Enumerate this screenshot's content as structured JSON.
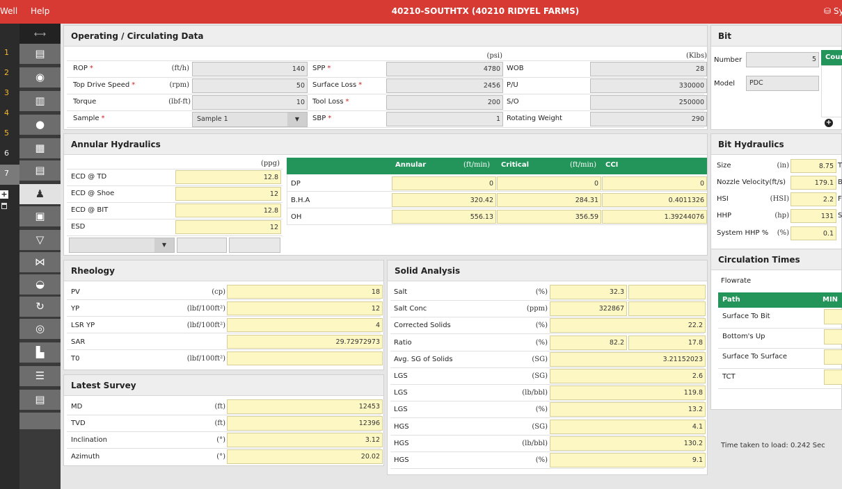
{
  "menu": {
    "well": "Well",
    "help": "Help",
    "title": "40210-SOUTHTX (40210 RIDYEL FARMS)",
    "sys": "Sy"
  },
  "nav": {
    "numbers": [
      "1",
      "2",
      "3",
      "4",
      "5",
      "6",
      "7"
    ],
    "resize_glyph": "⟷"
  },
  "op": {
    "title": "Operating / Circulating Data",
    "u_psi": "(psi)",
    "u_klbs": "(Klbs)",
    "rop": {
      "label": "ROP",
      "unit": "(ft/h)",
      "value": "140"
    },
    "tds": {
      "label": "Top Drive Speed",
      "unit": "(rpm)",
      "value": "50"
    },
    "torque": {
      "label": "Torque",
      "unit": "(lbf-ft)",
      "value": "10"
    },
    "sample": {
      "label": "Sample",
      "value": "Sample 1"
    },
    "spp": {
      "label": "SPP",
      "value": "4780"
    },
    "surface_loss": {
      "label": "Surface Loss",
      "value": "2456"
    },
    "tool_loss": {
      "label": "Tool Loss",
      "value": "200"
    },
    "sbp": {
      "label": "SBP",
      "value": "1"
    },
    "wob": {
      "label": "WOB",
      "value": "28"
    },
    "pu": {
      "label": "P/U",
      "value": "330000"
    },
    "so": {
      "label": "S/O",
      "value": "250000"
    },
    "rw": {
      "label": "Rotating Weight",
      "value": "290"
    }
  },
  "bit": {
    "title": "Bit",
    "number_label": "Number",
    "number_value": "5",
    "model_label": "Model",
    "model_value": "PDC",
    "green_tab": "Coun"
  },
  "ah": {
    "title": "Annular Hydraulics",
    "unit": "(ppg)",
    "rows": [
      {
        "label": "ECD @ TD",
        "value": "12.8"
      },
      {
        "label": "ECD @ Shoe",
        "value": "12"
      },
      {
        "label": "ECD @ BIT",
        "value": "12.8"
      },
      {
        "label": "ESD",
        "value": "12"
      }
    ],
    "grid_headers": {
      "annular": "Annular",
      "annular_unit": "(ft/min)",
      "critical": "Critical",
      "critical_unit": "(ft/min)",
      "cci": "CCI"
    },
    "grid_rows": [
      {
        "label": "DP",
        "annular": "0",
        "critical": "0",
        "cci": "0"
      },
      {
        "label": "B.H.A",
        "annular": "320.42",
        "critical": "284.31",
        "cci": "0.4011326"
      },
      {
        "label": "OH",
        "annular": "556.13",
        "critical": "356.59",
        "cci": "1.39244076"
      }
    ]
  },
  "bh": {
    "title": "Bit Hydraulics",
    "rows": [
      {
        "label": "Size",
        "unit": "(in)",
        "value": "8.75",
        "extra": "T"
      },
      {
        "label": "Nozzle Velocity(ft/s)",
        "unit": "",
        "value": "179.1",
        "extra": "B"
      },
      {
        "label": "HSI",
        "unit": "(HSI)",
        "value": "2.2",
        "extra": "F"
      },
      {
        "label": "HHP",
        "unit": "(hp)",
        "value": "131",
        "extra": "S"
      },
      {
        "label": "System HHP %",
        "unit": "(%)",
        "value": "0.1",
        "extra": ""
      }
    ]
  },
  "rh": {
    "title": "Rheology",
    "rows": [
      {
        "label": "PV",
        "unit": "(cp)",
        "value": "18"
      },
      {
        "label": "YP",
        "unit": "(lbf/100ft²)",
        "value": "12"
      },
      {
        "label": "LSR YP",
        "unit": "(lbf/100ft²)",
        "value": "4"
      },
      {
        "label": "SAR",
        "unit": "",
        "value": "29.72972973"
      },
      {
        "label": "T0",
        "unit": "(lbf/100ft²)",
        "value": ""
      }
    ]
  },
  "sa": {
    "title": "Solid Analysis",
    "rows": [
      {
        "label": "Salt",
        "unit": "(%)",
        "v1": "32.3",
        "v2": ""
      },
      {
        "label": "Salt Conc",
        "unit": "(ppm)",
        "v1": "322867",
        "v2": ""
      },
      {
        "label": "Corrected Solids",
        "unit": "(%)",
        "v": "22.2"
      },
      {
        "label": "Ratio",
        "unit": "(%)",
        "v1": "82.2",
        "v2": "17.8"
      },
      {
        "label": "Avg. SG of Solids",
        "unit": "(SG)",
        "v": "3.21152023"
      },
      {
        "label": "LGS",
        "unit": "(SG)",
        "v": "2.6"
      },
      {
        "label": "LGS",
        "unit": "(lb/bbl)",
        "v": "119.8"
      },
      {
        "label": "LGS",
        "unit": "(%)",
        "v": "13.2"
      },
      {
        "label": "HGS",
        "unit": "(SG)",
        "v": "4.1"
      },
      {
        "label": "HGS",
        "unit": "(lb/bbl)",
        "v": "130.2"
      },
      {
        "label": "HGS",
        "unit": "(%)",
        "v": "9.1"
      }
    ]
  },
  "ct": {
    "title": "Circulation Times",
    "flowrate": "Flowrate",
    "path_header": "Path",
    "min_header": "MIN",
    "rows": [
      "Surface To Bit",
      "Bottom's Up",
      "Surface To Surface",
      "TCT"
    ]
  },
  "ls": {
    "title": "Latest Survey",
    "rows": [
      {
        "label": "MD",
        "unit": "(ft)",
        "value": "12453"
      },
      {
        "label": "TVD",
        "unit": "(ft)",
        "value": "12396"
      },
      {
        "label": "Inclination",
        "unit": "(°)",
        "value": "3.12"
      },
      {
        "label": "Azimuth",
        "unit": "(°)",
        "value": "20.02"
      }
    ]
  },
  "footer": {
    "load_time": "Time taken to load: 0.242 Sec"
  }
}
